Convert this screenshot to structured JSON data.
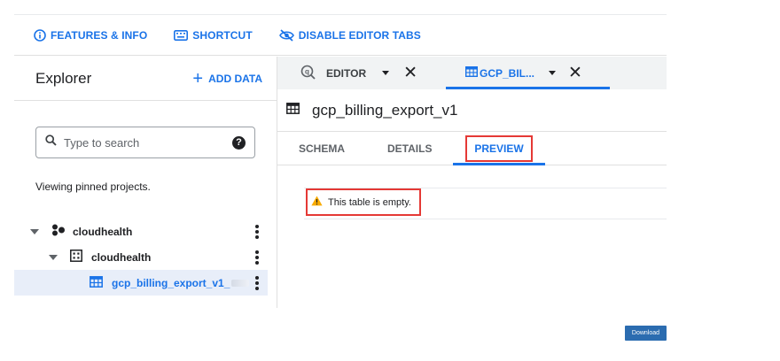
{
  "toolbar": {
    "features_label": "FEATURES & INFO",
    "shortcut_label": "SHORTCUT",
    "disable_tabs_label": "DISABLE EDITOR TABS"
  },
  "explorer": {
    "title": "Explorer",
    "add_data_label": "ADD DATA",
    "search_placeholder": "Type to search",
    "pinned_text": "Viewing pinned projects.",
    "tree": [
      {
        "label": "cloudhealth",
        "icon": "project-icon"
      },
      {
        "label": "cloudhealth",
        "icon": "dataset-icon"
      },
      {
        "label": "gcp_billing_export_v1_",
        "icon": "table-icon",
        "selected": true
      }
    ]
  },
  "editor_tabs": {
    "editor_label": "EDITOR",
    "table_label": "GCP_BIL..."
  },
  "table": {
    "name": "gcp_billing_export_v1",
    "tabs": [
      "SCHEMA",
      "DETAILS",
      "PREVIEW"
    ],
    "active_tab": "PREVIEW",
    "empty_message": "This table is empty."
  },
  "download_label": "Download",
  "colors": {
    "accent": "#1a73e8",
    "highlight_box": "#e53935",
    "warning": "#f9ab00",
    "selected_row_bg": "#e8eef9"
  }
}
